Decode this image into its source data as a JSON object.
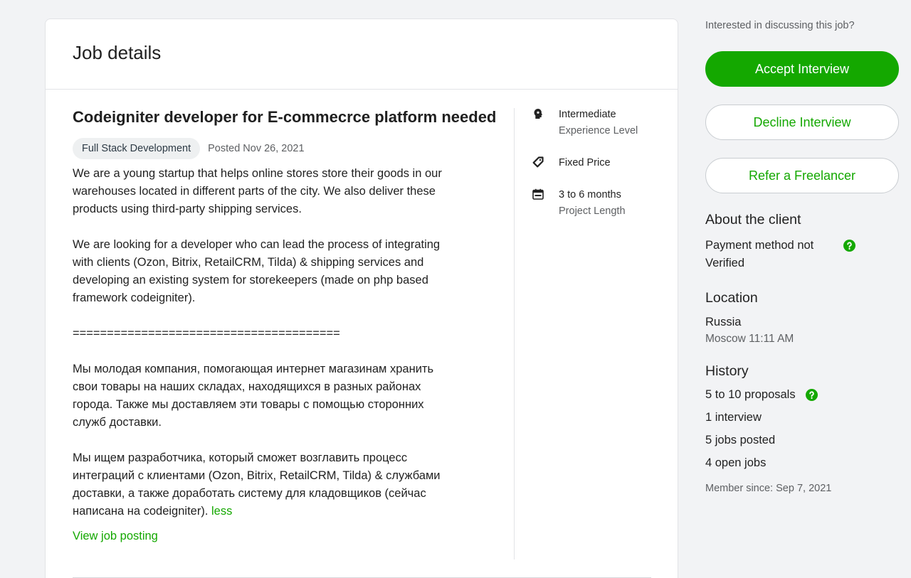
{
  "job": {
    "header": "Job details",
    "title": "Codeigniter developer for E-commecrce platform needed",
    "category": "Full Stack Development",
    "posted": "Posted Nov 26, 2021",
    "para1": "We are a young startup that helps online stores store their goods in our\nwarehouses located in different parts of the city. We also deliver these\nproducts using third-party shipping services.",
    "para2": "We are looking for a developer who can lead the process of integrating\nwith clients (Ozon, Bitrix, RetailCRM, Tilda) & shipping services and\ndeveloping an existing system for storekeepers (made on php based\nframework codeigniter).",
    "para3": "=======================================",
    "para4": "Мы молодая компания, помогающая интернет магазинам хранить\nсвои товары на наших складах, находящихся в разных районах\nгорода. Также мы доставляем эти товары с помощью сторонних\nслужб доставки.",
    "para5": "Мы ищем разработчика, который сможет возглавить процесс\nинтеграций с клиентами (Ozon, Bitrix, RetailCRM, Tilda) & службами\nдоставки, а также доработать систему для кладовщиков (сейчас\nнаписана на codeigniter).",
    "less": "less",
    "view_posting": "View job posting",
    "experience": {
      "value": "Intermediate",
      "label": "Experience Level",
      "icon": "brain-icon"
    },
    "price": {
      "value": "Fixed Price",
      "icon": "tag-icon"
    },
    "length": {
      "value": "3 to 6 months",
      "label": "Project Length",
      "icon": "calendar-icon"
    }
  },
  "actions": {
    "prompt": "Interested in discussing this job?",
    "accept": "Accept Interview",
    "decline": "Decline Interview",
    "refer": "Refer a Freelancer"
  },
  "client": {
    "about_title": "About the client",
    "payment": "Payment method not\nVerified",
    "location_title": "Location",
    "country": "Russia",
    "city_time": "Moscow 11:11 AM",
    "history_title": "History",
    "proposals": "5 to 10 proposals",
    "interviews": "1 interview",
    "jobs_posted": "5 jobs posted",
    "open_jobs": "4 open jobs",
    "member_since": "Member since: Sep 7, 2021"
  },
  "colors": {
    "accent": "#14a800",
    "muted": "#5e6063"
  }
}
